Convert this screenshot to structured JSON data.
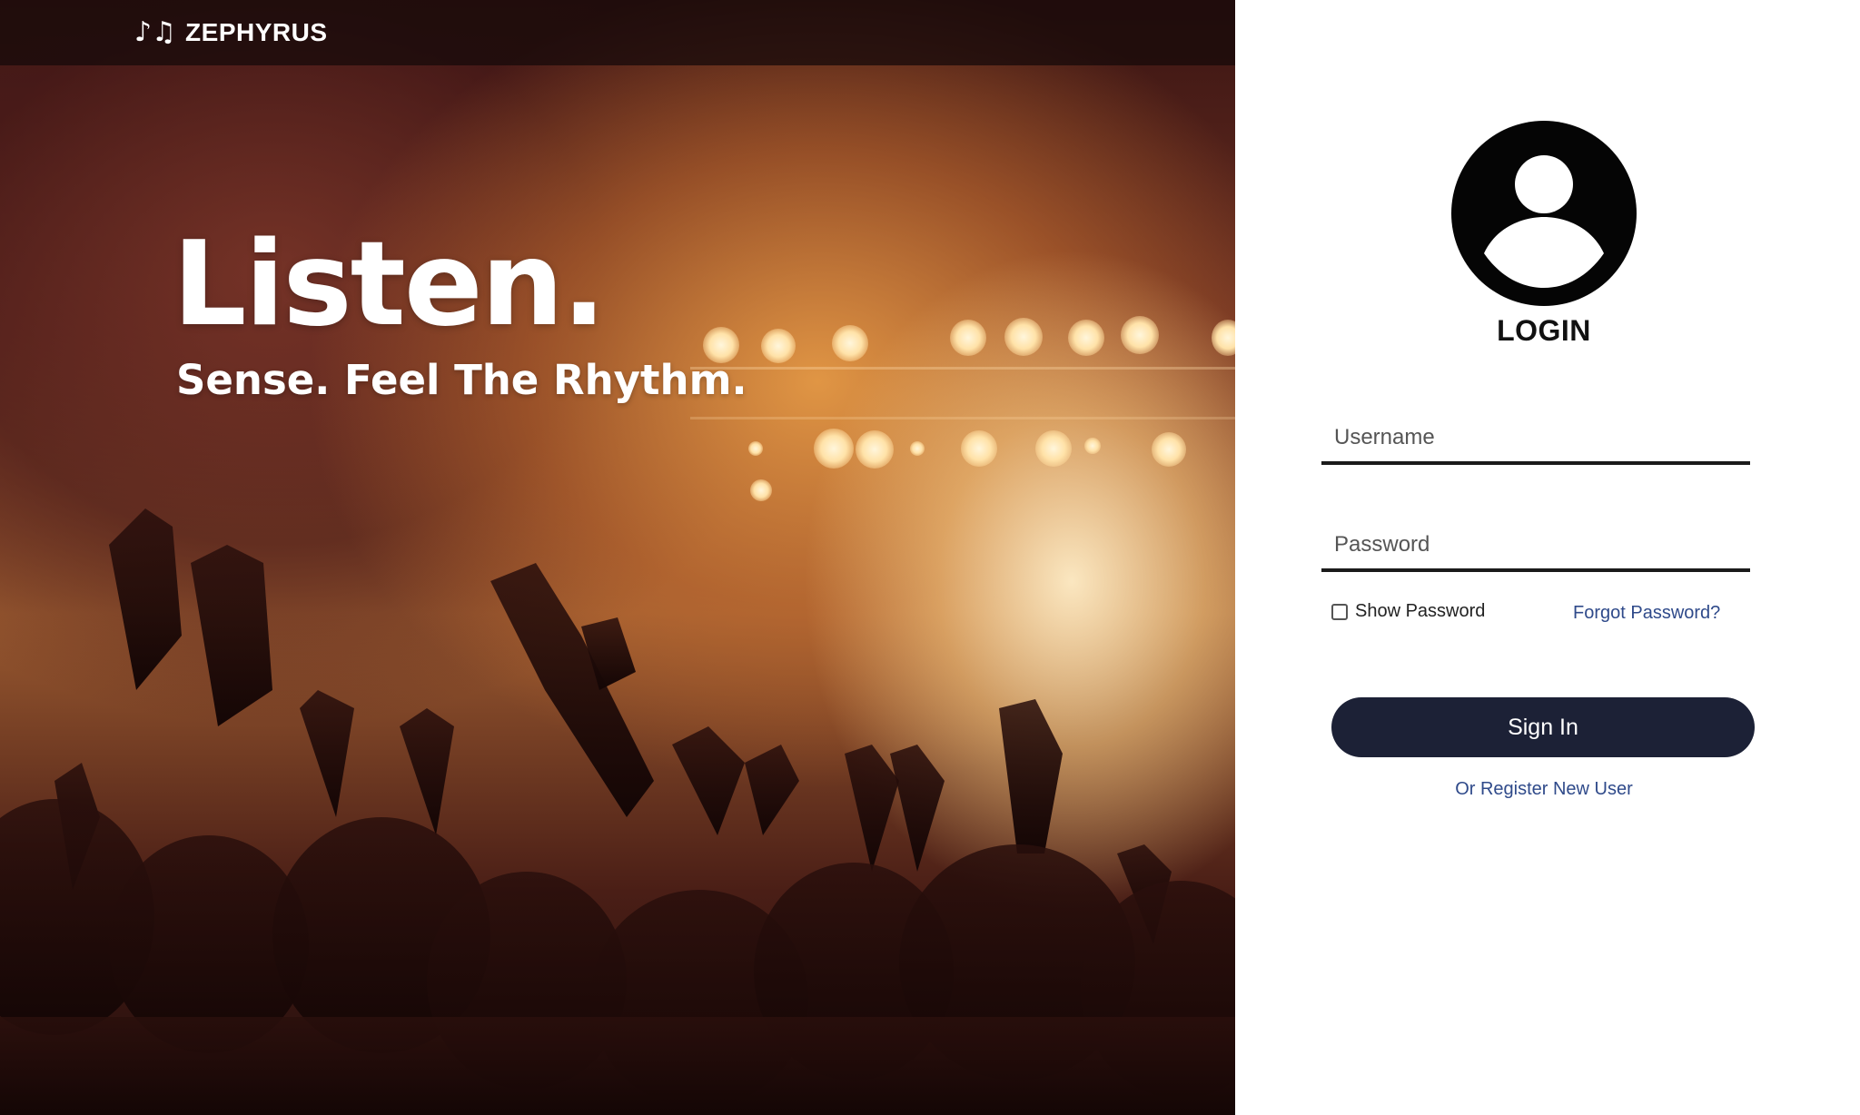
{
  "brand": {
    "name": "ZEPHYRUS",
    "icon": "music-notes-icon"
  },
  "hero": {
    "headline": "Listen.",
    "subheadline": "Sense. Feel The Rhythm.",
    "image": "concert-crowd-photo"
  },
  "login": {
    "avatar_icon": "user-circle-icon",
    "title": "LOGIN",
    "username_placeholder": "Username",
    "username_value": "",
    "password_placeholder": "Password",
    "password_value": "",
    "show_password_label": "Show Password",
    "show_password_checked": false,
    "forgot_password_label": "Forgot Password?",
    "sign_in_label": "Sign In",
    "register_label": "Or Register New User"
  },
  "colors": {
    "button_bg": "#1c2136",
    "link": "#2f4a8a",
    "hero_warm": "#e9a35a",
    "hero_dark": "#3b1513"
  }
}
